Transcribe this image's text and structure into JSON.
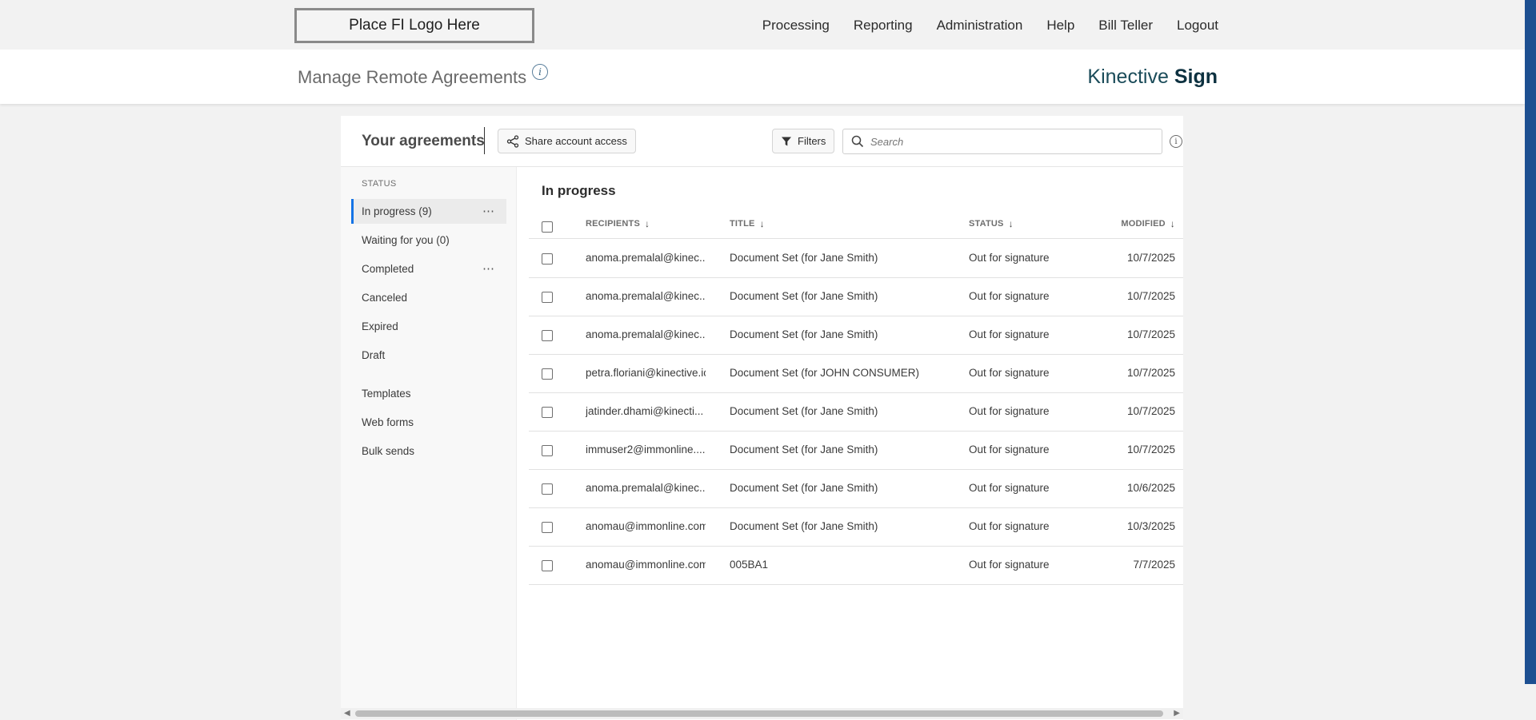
{
  "topbar": {
    "logo": "Place FI Logo Here",
    "nav": [
      "Processing",
      "Reporting",
      "Administration",
      "Help",
      "Bill Teller",
      "Logout"
    ]
  },
  "header": {
    "title": "Manage Remote Agreements",
    "info_glyph": "i",
    "brand_regular": "Kinective",
    "brand_bold": "Sign"
  },
  "toolbar": {
    "title": "Your agreements",
    "share_label": "Share account access",
    "filters_label": "Filters",
    "search_placeholder": "Search",
    "info_glyph": "i"
  },
  "sidebar": {
    "heading": "STATUS",
    "items": [
      {
        "label": "In progress (9)",
        "active": true,
        "menu": true
      },
      {
        "label": "Waiting for you (0)",
        "active": false,
        "menu": false
      },
      {
        "label": "Completed",
        "active": false,
        "menu": true
      },
      {
        "label": "Canceled",
        "active": false,
        "menu": false
      },
      {
        "label": "Expired",
        "active": false,
        "menu": false
      },
      {
        "label": "Draft",
        "active": false,
        "menu": false
      }
    ],
    "extra_items": [
      "Templates",
      "Web forms",
      "Bulk sends"
    ],
    "menu_glyph": "⋯"
  },
  "table": {
    "section_title": "In progress",
    "columns": {
      "recipients": "RECIPIENTS",
      "title": "TITLE",
      "status": "STATUS",
      "modified": "MODIFIED"
    },
    "sort_glyph": "↓",
    "rows": [
      {
        "recipients": "anoma.premalal@kinec...",
        "title": "Document Set (for Jane Smith)",
        "status": "Out for signature",
        "modified": "10/7/2025"
      },
      {
        "recipients": "anoma.premalal@kinec...",
        "title": "Document Set (for Jane Smith)",
        "status": "Out for signature",
        "modified": "10/7/2025"
      },
      {
        "recipients": "anoma.premalal@kinec...",
        "title": "Document Set (for Jane Smith)",
        "status": "Out for signature",
        "modified": "10/7/2025"
      },
      {
        "recipients": "petra.floriani@kinective.io",
        "title": "Document Set (for JOHN CONSUMER)",
        "status": "Out for signature",
        "modified": "10/7/2025"
      },
      {
        "recipients": "jatinder.dhami@kinecti...",
        "title": "Document Set (for Jane Smith)",
        "status": "Out for signature",
        "modified": "10/7/2025"
      },
      {
        "recipients": "immuser2@immonline....",
        "title": "Document Set (for Jane Smith)",
        "status": "Out for signature",
        "modified": "10/7/2025"
      },
      {
        "recipients": "anoma.premalal@kinec...",
        "title": "Document Set (for Jane Smith)",
        "status": "Out for signature",
        "modified": "10/6/2025"
      },
      {
        "recipients": "anomau@immonline.com",
        "title": "Document Set (for Jane Smith)",
        "status": "Out for signature",
        "modified": "10/3/2025"
      },
      {
        "recipients": "anomau@immonline.com",
        "title": "005BA1",
        "status": "Out for signature",
        "modified": "7/7/2025"
      }
    ]
  },
  "colors": {
    "accent_blue": "#1473e6",
    "right_accent": "#1d4f91",
    "brand": "#0d3140"
  }
}
